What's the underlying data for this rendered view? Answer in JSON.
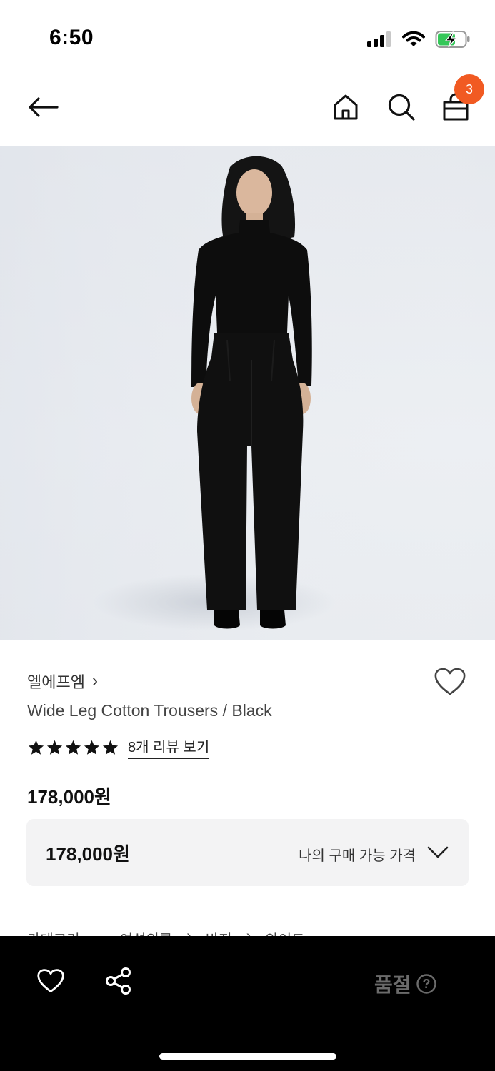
{
  "status_bar": {
    "time": "6:50"
  },
  "header": {
    "cart_count": "3"
  },
  "product": {
    "brand": "엘에프엠",
    "brand_chevron": "›",
    "name": "Wide Leg Cotton Trousers / Black",
    "rating_stars": 5,
    "review_link": "8개 리뷰 보기",
    "price": "178,000원",
    "my_price": "178,000원",
    "my_price_label": "나의 구매 가능 가격"
  },
  "category_row": {
    "label": "카테고리",
    "path": [
      "여성의류",
      "›",
      "바지",
      "›",
      "와이드"
    ]
  },
  "bottom_bar": {
    "status": "품절",
    "help_icon": "?"
  },
  "colors": {
    "accent": "#f15a22",
    "bottom_bar": "#000000",
    "price_box": "#f3f3f4"
  },
  "icons": [
    "back-arrow-icon",
    "home-icon",
    "search-icon",
    "shopping-bag-icon",
    "heart-icon",
    "star-icon",
    "chevron-down-icon",
    "share-icon",
    "question-circle-icon"
  ]
}
